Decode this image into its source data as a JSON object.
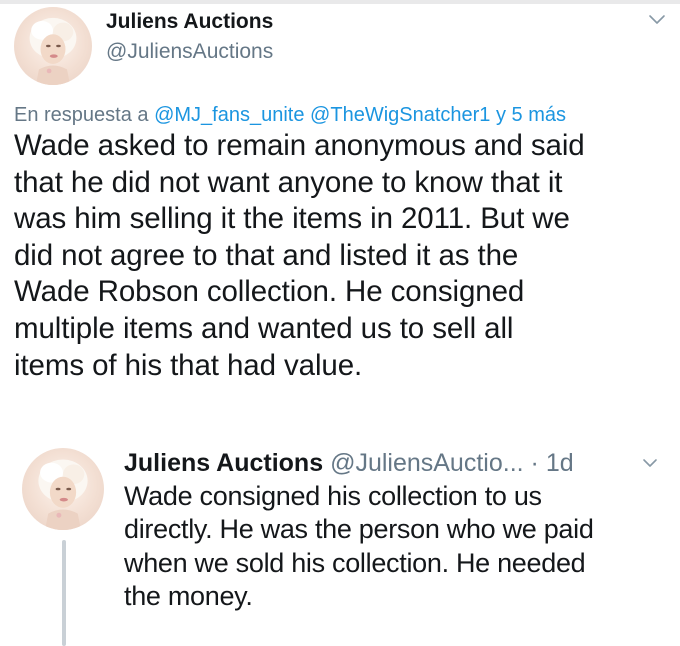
{
  "main_tweet": {
    "author": {
      "display_name": "Juliens Auctions",
      "handle": "@JuliensAuctions"
    },
    "reply_context": {
      "prefix": "En respuesta a",
      "mentions": [
        "@MJ_fans_unite",
        "@TheWigSnatcher1"
      ],
      "suffix": "y 5 más"
    },
    "text_lines": [
      "Wade asked to remain anonymous and said",
      "that he did not want anyone to know that it",
      "was him selling it the items in 2011. But we",
      "did not agree to that and listed it as the",
      "Wade Robson collection. He consigned",
      "multiple items and wanted us to sell all",
      "items of his that had value."
    ]
  },
  "reply_tweet": {
    "author": {
      "display_name": "Juliens Auctions",
      "handle": "@JuliensAuctio..."
    },
    "separator": "·",
    "timestamp": "1d",
    "text_lines": [
      "Wade consigned his collection to us",
      "directly. He was the person who we paid",
      "when we sold his collection. He needed",
      "the money."
    ]
  },
  "icons": {
    "menu_caret": "chevron-down-icon",
    "avatar": "profile-photo"
  },
  "colors": {
    "text_primary": "#14171a",
    "text_secondary": "#657786",
    "link": "#1b95e0",
    "thread_line": "#c9d0d6"
  }
}
